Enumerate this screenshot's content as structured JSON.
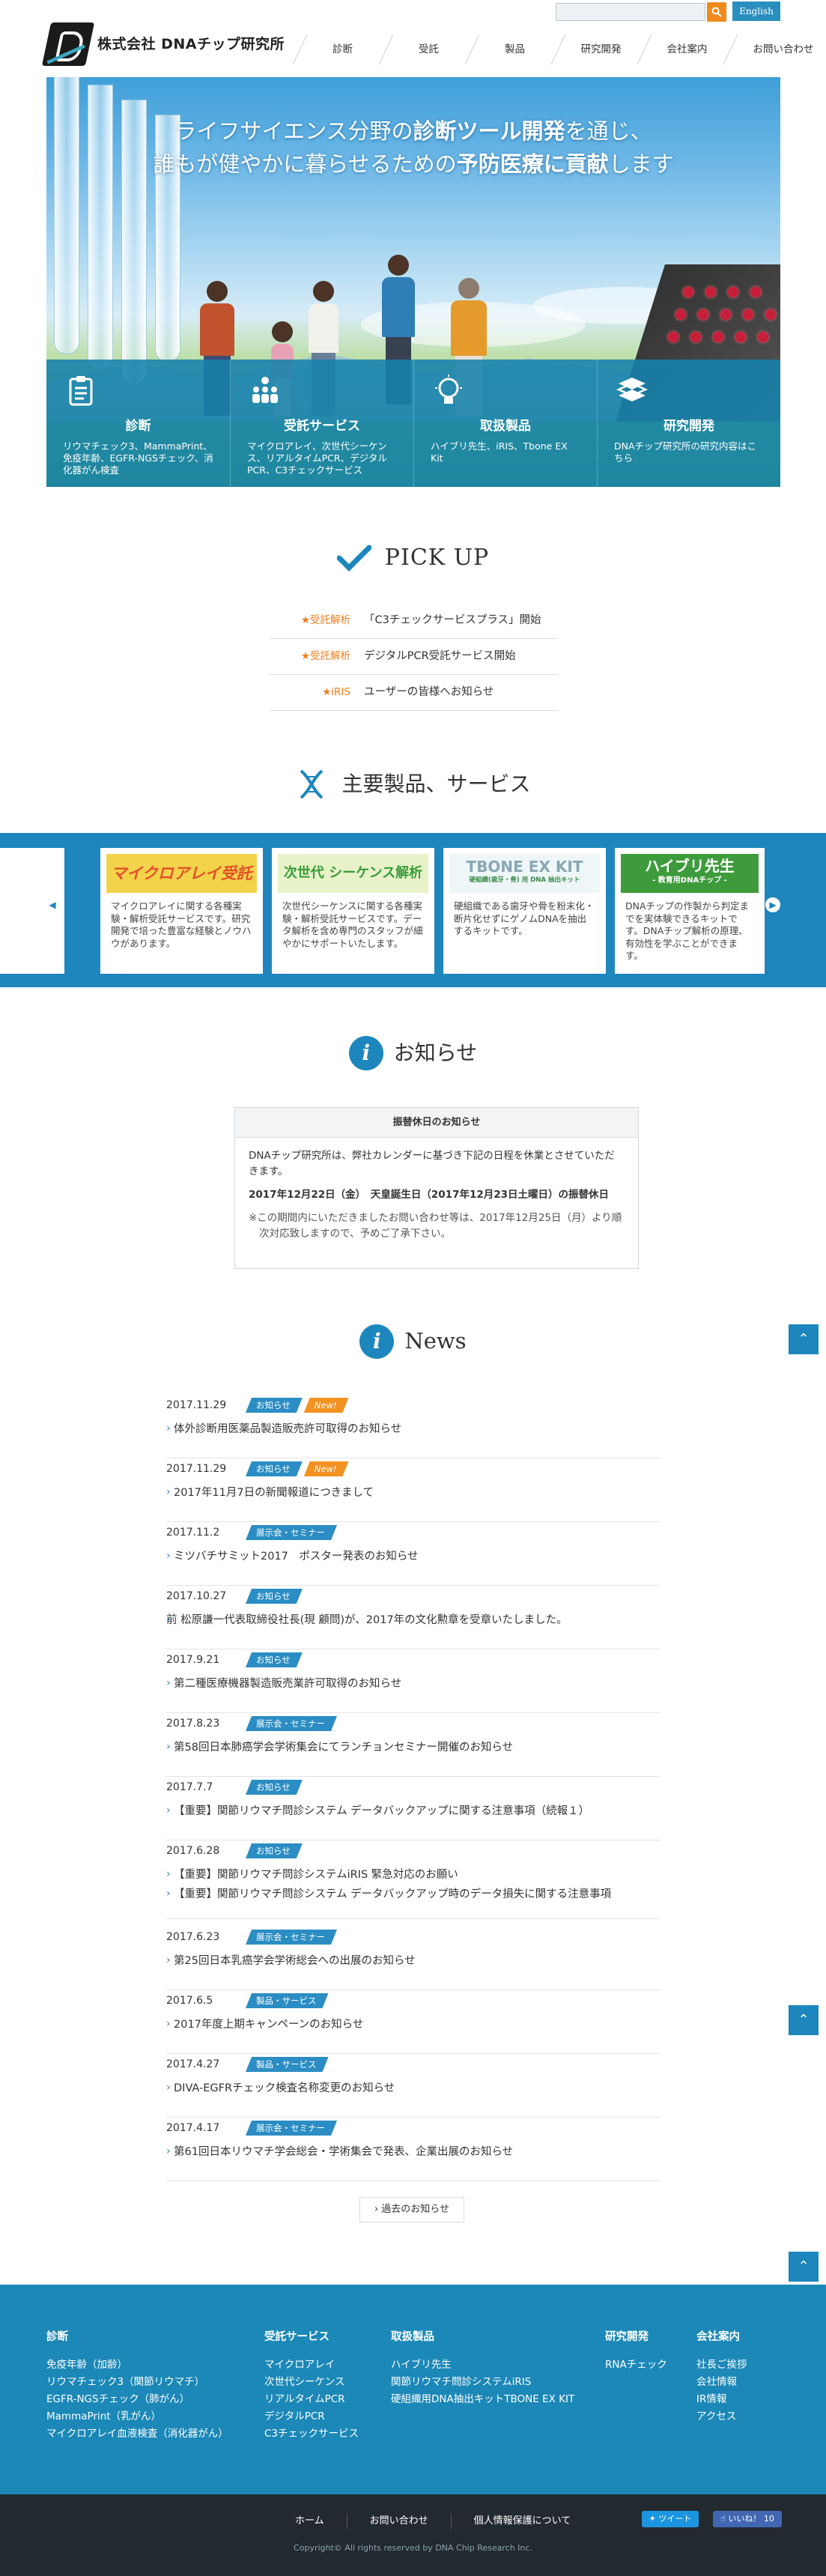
{
  "header": {
    "company": "株式会社 DNAチップ研究所",
    "english": "English",
    "search_placeholder": "",
    "nav": [
      "診断",
      "受託",
      "製品",
      "研究開発",
      "会社案内",
      "お問い合わせ"
    ]
  },
  "hero": {
    "line1_a": "ライフサイエンス分野の",
    "line1_b": "診断ツール開発",
    "line1_c": "を通じ、",
    "line2_a": "誰もが健やかに暮らせるための",
    "line2_b": "予防医療に貢献",
    "line2_c": "します",
    "boxes": [
      {
        "title": "診断",
        "desc": "リウマチェック3、MammaPrint、免疫年齢、EGFR-NGSチェック、消化器がん検査",
        "icon": "clipboard-icon"
      },
      {
        "title": "受託サービス",
        "desc": "マイクロアレイ、次世代シーケンス、リアルタイムPCR、デジタルPCR、C3チェックサービス",
        "icon": "people-icon"
      },
      {
        "title": "取扱製品",
        "desc": "ハイブリ先生、iRIS、Tbone EX Kit",
        "icon": "lightbulb-icon"
      },
      {
        "title": "研究開発",
        "desc": "DNAチップ研究所の研究内容はこちら",
        "icon": "books-icon"
      }
    ]
  },
  "pickup": {
    "title": "PICK UP",
    "items": [
      {
        "cat": "★受託解析",
        "text": "「C3チェックサービスプラス」開始"
      },
      {
        "cat": "★受託解析",
        "text": "デジタルPCR受託サービス開始"
      },
      {
        "cat": "★iRIS",
        "text": "ユーザーの皆様へお知らせ"
      }
    ]
  },
  "products": {
    "title": "主要製品、サービス",
    "cards": [
      {
        "banner": "マイクロアレイ受託",
        "desc": "マイクロアレイに関する各種実験・解析受託サービスです。研究開発で培った豊富な経験とノウハウがあります。"
      },
      {
        "banner": "次世代 シーケンス解析",
        "desc": "次世代シーケンスに関する各種実験・解析受託サービスです。データ解析を含め専門のスタッフが細やかにサポートいたします。"
      },
      {
        "banner": "TBONE EX KIT",
        "sub": "硬組織(歯牙・骨) 用 DNA 抽出キット",
        "desc": "硬組織である歯牙や骨を粉末化・断片化せずにゲノムDNAを抽出するキットです。"
      },
      {
        "banner": "ハイブリ先生",
        "sub": "- 教育用DNAチップ -",
        "desc": "DNAチップの作製から判定までを実体験できるキットです。DNAチップ解析の原理、有効性を学ぶことができます。"
      }
    ]
  },
  "notice": {
    "title": "お知らせ",
    "box_title": "振替休日のお知らせ",
    "p1": "DNAチップ研究所は、弊社カレンダーに基づき下記の日程を休業とさせていただきます。",
    "p2": "2017年12月22日（金）　天皇誕生日（2017年12月23日土曜日）の振替休日",
    "p3": "※この期間内にいただきましたお問い合わせ等は、2017年12月25日（月）より順次対応致しますので、予めご了承下さい。"
  },
  "news": {
    "title": "News",
    "items": [
      {
        "date": "2017.11.29",
        "tags": [
          "お知らせ"
        ],
        "new": "New!",
        "titles": [
          "体外診断用医薬品製造販売許可取得のお知らせ"
        ]
      },
      {
        "date": "2017.11.29",
        "tags": [
          "お知らせ"
        ],
        "new": "New!",
        "titles": [
          "2017年11月7日の新聞報道につきまして"
        ]
      },
      {
        "date": "2017.11.2",
        "tags": [
          "展示会・セミナー"
        ],
        "titles": [
          "ミツバチサミット2017　ポスター発表のお知らせ"
        ]
      },
      {
        "date": "2017.10.27",
        "tags": [
          "お知らせ"
        ],
        "titles": [
          "前 松原謙一代表取締役社長(現 顧問)が、2017年の文化勲章を受章いたしました。"
        ]
      },
      {
        "date": "2017.9.21",
        "tags": [
          "お知らせ"
        ],
        "titles": [
          "第二種医療機器製造販売業許可取得のお知らせ"
        ]
      },
      {
        "date": "2017.8.23",
        "tags": [
          "展示会・セミナー"
        ],
        "titles": [
          "第58回日本肺癌学会学術集会にてランチョンセミナー開催のお知らせ"
        ]
      },
      {
        "date": "2017.7.7",
        "tags": [
          "お知らせ"
        ],
        "titles": [
          "【重要】関節リウマチ問診システム データバックアップに関する注意事項（続報１）"
        ]
      },
      {
        "date": "2017.6.28",
        "tags": [
          "お知らせ"
        ],
        "titles": [
          "【重要】関節リウマチ問診システムiRIS 緊急対応のお願い",
          "【重要】関節リウマチ問診システム データバックアップ時のデータ損失に関する注意事項"
        ]
      },
      {
        "date": "2017.6.23",
        "tags": [
          "展示会・セミナー"
        ],
        "titles": [
          "第25回日本乳癌学会学術総会への出展のお知らせ"
        ]
      },
      {
        "date": "2017.6.5",
        "tags": [
          "製品・サービス"
        ],
        "titles": [
          "2017年度上期キャンペーンのお知らせ"
        ]
      },
      {
        "date": "2017.4.27",
        "tags": [
          "製品・サービス"
        ],
        "titles": [
          "DIVA-EGFRチェック検査名称変更のお知らせ"
        ]
      },
      {
        "date": "2017.4.17",
        "tags": [
          "展示会・セミナー"
        ],
        "titles": [
          "第61回日本リウマチ学会総会・学術集会で発表、企業出展のお知らせ"
        ]
      }
    ],
    "past": "過去のお知らせ"
  },
  "footer": {
    "cols": [
      {
        "head": "診断",
        "items": [
          "免疫年齢（加齢）",
          "リウマチェック3（関節リウマチ）",
          "EGFR-NGSチェック（肺がん）",
          "MammaPrint（乳がん）",
          "マイクロアレイ血液検査（消化器がん）"
        ]
      },
      {
        "head": "受託サービス",
        "items": [
          "マイクロアレイ",
          "次世代シーケンス",
          "リアルタイムPCR",
          "デジタルPCR",
          "C3チェックサービス"
        ]
      },
      {
        "head": "取扱製品",
        "items": [
          "ハイブリ先生",
          "関節リウマチ問診システムiRIS",
          "硬組織用DNA抽出キットTBONE EX KIT"
        ]
      },
      {
        "head": "研究開発",
        "items": [
          "RNAチェック"
        ]
      },
      {
        "head": "会社案内",
        "items": [
          "社長ご挨拶",
          "会社情報",
          "IR情報",
          "アクセス"
        ]
      }
    ],
    "bottom_links": [
      "ホーム",
      "お問い合わせ",
      "個人情報保護について"
    ],
    "tweet": "ツイート",
    "like": "いいね！ 10",
    "copyright": "Copyright© All rights reserved by DNA Chip Research Inc."
  },
  "colors": {
    "accent": "#1d87bd",
    "orange": "#f08a1a",
    "footer": "#1b88b8",
    "bottom": "#232a2f"
  }
}
